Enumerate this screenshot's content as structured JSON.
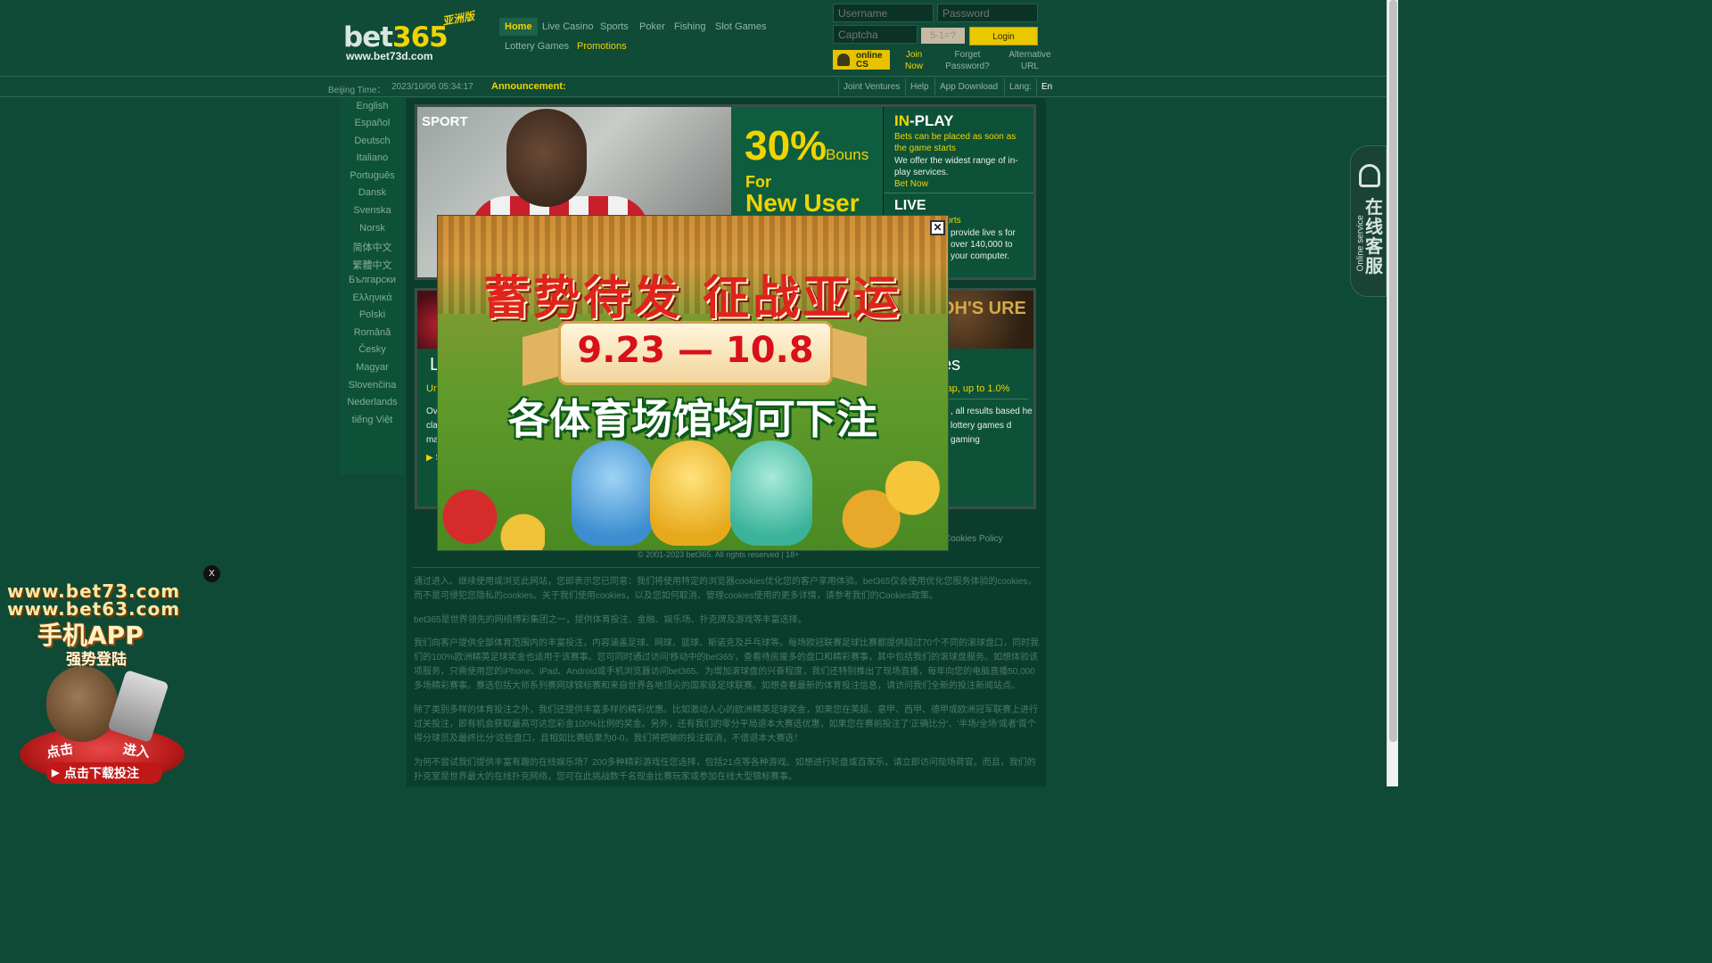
{
  "header": {
    "logo_brand_main": "bet",
    "logo_brand_accent": "365",
    "logo_asia": "亚洲版",
    "logo_url": "www.bet73d.com",
    "nav": [
      "Home",
      "Live Casino",
      "Sports",
      "Poker",
      "Fishing",
      "Slot Games",
      "Lottery Games",
      "Promotions"
    ],
    "login": {
      "username_placeholder": "Username",
      "password_placeholder": "Password",
      "captcha_placeholder": "Captcha",
      "captcha_image_text": "5-1=?",
      "login_label": "Login",
      "online_cs_label": "online CS",
      "join_now": "Join Now",
      "forget_password": "Forget Password?",
      "alternative_url": "Alternative URL"
    }
  },
  "infobar": {
    "time_label": "Beijing Time：",
    "time_value": "2023/10/06 05:34:17",
    "announcement": "Announcement:",
    "tools": [
      "Joint Ventures",
      "Help",
      "App Download",
      "Lang:",
      "En"
    ]
  },
  "languages": [
    "English",
    "Español",
    "Deutsch",
    "Italiano",
    "Português",
    "Dansk",
    "Svenska",
    "Norsk",
    "简体中文",
    "繁體中文",
    "Български",
    "Ελληνικά",
    "Polski",
    "Română",
    "Česky",
    "Magyar",
    "Slovenčina",
    "Nederlands",
    "tiếng Việt"
  ],
  "sport_panel": {
    "title": "SPORT",
    "bonus_pct": "30%",
    "bonus_word": "Bouns",
    "bonus_for": "For",
    "bonus_new_user": "New User",
    "inplay_title_accent": "IN",
    "inplay_title_rest": "-PLAY",
    "inplay_p1": "Bets can be placed as soon as the game starts",
    "inplay_p2": "We offer the widest range of in-play services.",
    "bet_now": "Bet Now",
    "live_title": "LIVE",
    "live_sports": "orts",
    "live_text": "provide live s for over 140,000 to your computer."
  },
  "lower_panel": {
    "casino_title": "L",
    "casino_sub": "Un",
    "casino_text": "Ove clas maj",
    "casino_link": "S",
    "lottery_img_text": "OH'S URE",
    "lottery_title": "es",
    "lottery_sub": "cap, up to 1.0%",
    "lottery_text": ", all results based he lottery games d gaming"
  },
  "footer": {
    "links": "Cookies Policy",
    "copyright": "© 2001-2023 bet365. All rights reserved | 18+",
    "paragraphs": [
      "通过进入、继续使用或浏览此网站，您即表示您已同意：我们将使用特定的浏览器cookies优化您的客户享用体验。bet365仅会使用优化您服务体验的cookies，而不是可侵犯您隐私的cookies。关于我们使用cookies，以及您如何取消、管理cookies使用的更多详情，请参考我们的Cookies政策。",
      "bet365是世界领先的网络博彩集团之一，提供体育投注、金融、娱乐场、扑克牌及游戏等丰富选择。",
      "我们向客户提供全部体育范围内的丰富投注，内容涵盖足球、网球、篮球、斯诺克及乒乓球等。每场欧冠联赛足球比赛都提供超过70个不同的滚球盘口，同时我们的100%欧洲精英足球奖金也适用于该赛事。您可同时通过访问'移动中的bet365'，查看待房屋多的盘口和精彩赛事，其中包括我们的滚球盘服务。如想体验该项服务，只需使用您的iPhone、iPad、Android或手机浏览器访问bet365。为增加滚球盘的兴奋程度，我们还特别推出了现场直播，每年向您的电脑直播50,000多场精彩赛事。赛选包括大师系列赛网球锦标赛和来自世界各地顶尖的国家级足球联赛。如想查看最新的体育投注信息，请访问我们全新的投注新闻站点。",
      "除了类别多样的体育投注之外，我们还提供丰富多样的精彩优惠。比如激动人心的欧洲精英足球奖金，如果您在英超、意甲、西甲、德甲或欧洲冠军联赛上进行过关投注，即有机会获取最高可达您彩金100%比例的奖金。另外，还有我们的零分平局退本大赛选优惠，如果您在赛前投注了'正确比分'、'半场/全场'或者'首个得分球员及最终比分'这些盘口，且相如比赛结果为0-0，我们将把输的投注取消，不借退本大赛选！",
      "为何不尝试我们提供丰富有趣的在线娱乐场？200多种精彩游戏任您选择，包括21点等各种游戏。如想进行轮盘或百家乐，请立即访问现场荷官。而且，我们的扑克室是世界最大的在线扑克网络，您可在此挑战数千名现金比赛玩家或参加在线大型锦标赛事。"
    ]
  },
  "popup": {
    "headline": "蓄势待发 征战亚运",
    "dates": "9.23 — 10.8",
    "subhead": "各体育场馆均可下注",
    "close_symbol": "✕"
  },
  "app_ad": {
    "close_label": "X",
    "domain1": "www.bet73.com",
    "domain2": "www.bet63.com",
    "title": "手机APP",
    "strong": "强势登陆",
    "click": "点击",
    "enter": "进入",
    "download": "点击下载投注"
  },
  "online_service": {
    "label_en": "Online service",
    "label_cn": "在线客服"
  },
  "colors": {
    "background": "#0e4a36",
    "accent_yellow": "#f0d400",
    "panel_green": "#0d5238"
  }
}
